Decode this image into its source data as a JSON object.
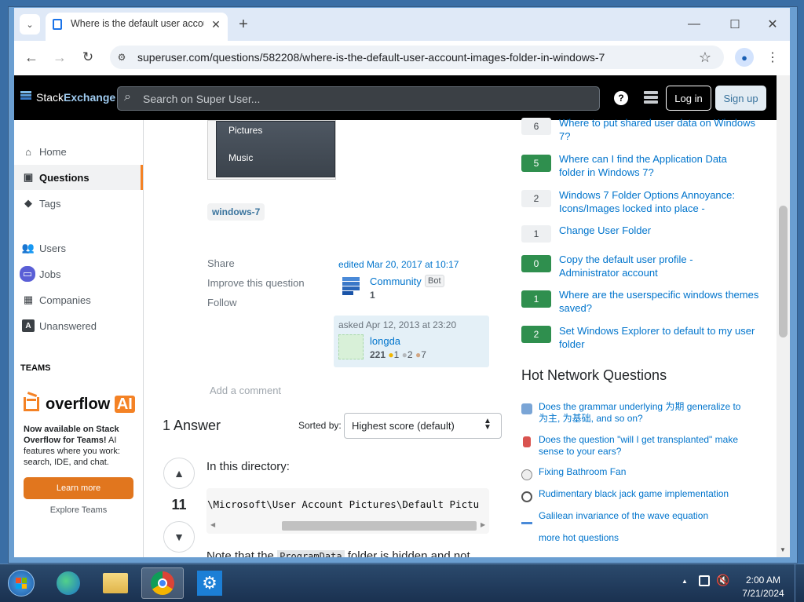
{
  "browser": {
    "tab_title": "Where is the default user accou",
    "url": "superuser.com/questions/582208/where-is-the-default-user-account-images-folder-in-windows-7"
  },
  "header": {
    "logo_a": "Stack",
    "logo_b": "Exchange",
    "search_placeholder": "Search on Super User...",
    "login": "Log in",
    "signup": "Sign up"
  },
  "sidebar": {
    "items": [
      {
        "label": "Home"
      },
      {
        "label": "Questions"
      },
      {
        "label": "Tags"
      },
      {
        "label": "Users"
      },
      {
        "label": "Jobs"
      },
      {
        "label": "Companies"
      },
      {
        "label": "Unanswered"
      }
    ],
    "teams_title": "TEAMS",
    "overflow": "overflow",
    "ai": "AI",
    "promo_bold": "Now available on Stack Overflow for Teams!",
    "promo_rest": " AI features where you work: search, IDE, and chat.",
    "learn_more": "Learn more",
    "explore": "Explore Teams"
  },
  "question": {
    "menu_items": [
      "Pictures",
      "Music"
    ],
    "tag": "windows-7",
    "share": "Share",
    "improve": "Improve this question",
    "follow": "Follow",
    "edited": "edited Mar 20, 2017 at 10:17",
    "editor": "Community",
    "bot": "Bot",
    "editor_rep": "1",
    "asked": "asked Apr 12, 2013 at 23:20",
    "asker": "longda",
    "asker_rep": "221",
    "gold": "1",
    "silver": "2",
    "bronze": "7",
    "add_comment": "Add a comment"
  },
  "answers": {
    "count_label": "1 Answer",
    "sorted_by": "Sorted by:",
    "sort_value": "Highest score (default)",
    "score": "11",
    "intro": "In this directory:",
    "code": "\\Microsoft\\User Account Pictures\\Default Pictures",
    "next_line_a": "Note that the",
    "next_code": "ProgramData",
    "next_line_b": "folder is hidden and not"
  },
  "related": [
    {
      "votes": "6",
      "accepted": false,
      "title_1": "Where to put shared user data on Windows",
      "title_2": "7?"
    },
    {
      "votes": "5",
      "accepted": true,
      "title_1": "Where can I find the Application Data",
      "title_2": "folder in Windows 7?"
    },
    {
      "votes": "2",
      "accepted": false,
      "title_1": "Windows 7 Folder Options Annoyance:",
      "title_2": "Icons/Images locked into place -"
    },
    {
      "votes": "1",
      "accepted": false,
      "title_1": "Change User Folder",
      "title_2": ""
    },
    {
      "votes": "0",
      "accepted": true,
      "title_1": "Copy the default user profile -",
      "title_2": "Administrator account"
    },
    {
      "votes": "1",
      "accepted": true,
      "title_1": "Where are the userspecific windows themes",
      "title_2": "saved?"
    },
    {
      "votes": "2",
      "accepted": true,
      "title_1": "Set Windows Explorer to default to my user",
      "title_2": "folder"
    }
  ],
  "hot": {
    "title": "Hot Network Questions",
    "items": [
      {
        "l1": "Does the grammar underlying 为期 generalize to",
        "l2": "为主, 为基础, and so on?"
      },
      {
        "l1": "Does the question \"will I get transplanted\" make",
        "l2": "sense to your ears?"
      },
      {
        "l1": "Fixing Bathroom Fan",
        "l2": ""
      },
      {
        "l1": "Rudimentary black jack game implementation",
        "l2": ""
      },
      {
        "l1": "Galilean invariance of the wave equation",
        "l2": ""
      }
    ],
    "more": "more hot questions"
  },
  "taskbar": {
    "time": "2:00 AM",
    "date": "7/21/2024"
  },
  "colors": {
    "accepted": "#2f8f4e",
    "link": "#0074cc",
    "orange": "#f48225"
  }
}
